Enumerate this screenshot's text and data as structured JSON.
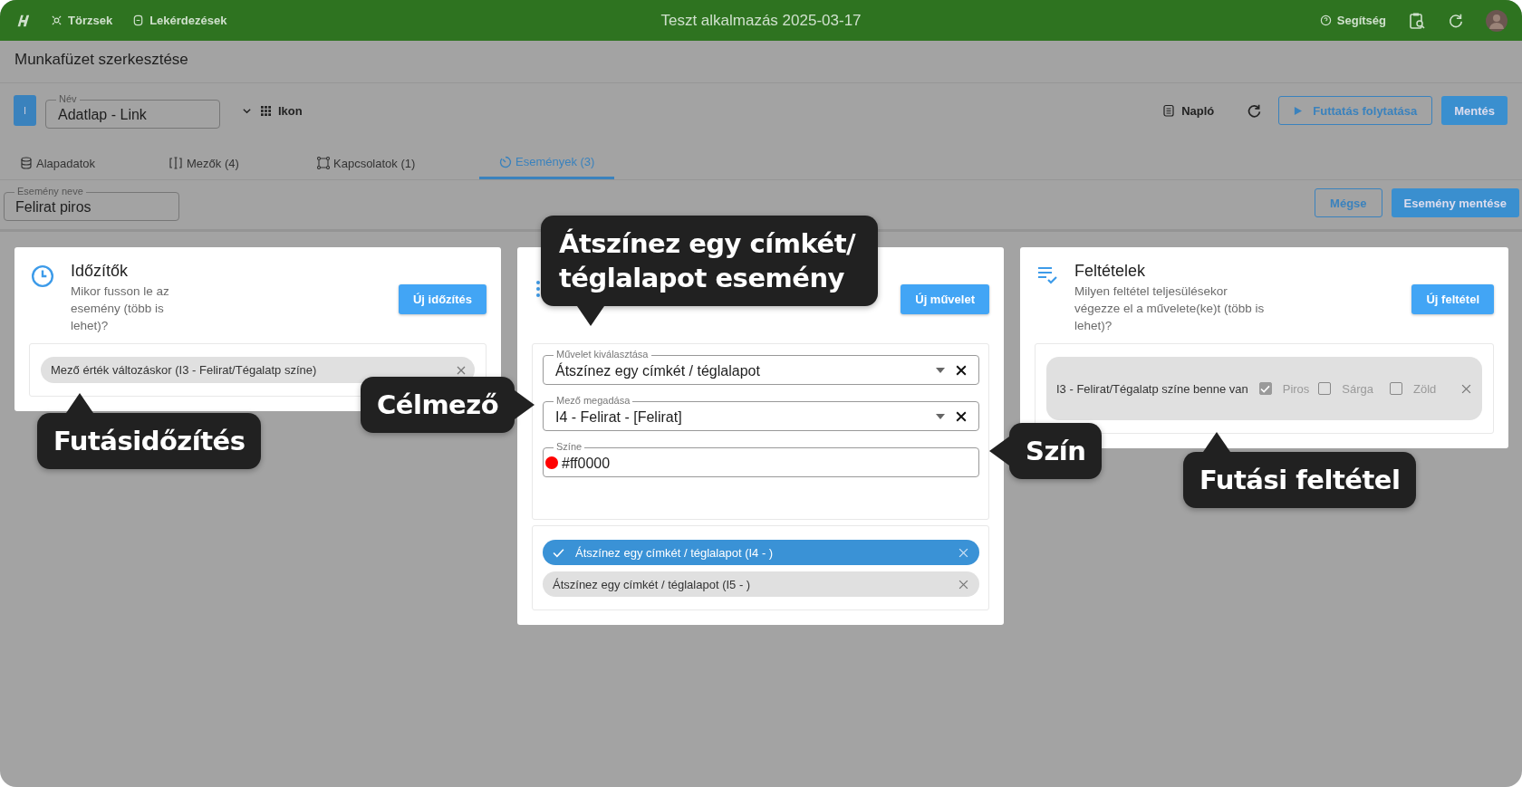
{
  "header": {
    "nav": [
      "Törzsek",
      "Lekérdezések"
    ],
    "title": "Teszt alkalmazás 2025-03-17",
    "help": "Segítség"
  },
  "page_title": "Munkafüzet szerkesztése",
  "toolbar": {
    "badge": "I",
    "name_field": {
      "label": "Név",
      "value": "Adatlap - Link"
    },
    "icon_picker": "Ikon",
    "log": "Napló",
    "run_button": "Futtatás folytatása",
    "save_button": "Mentés"
  },
  "tabs": [
    {
      "label": "Alapadatok",
      "selected": false
    },
    {
      "label": "Mezők (4)",
      "selected": false
    },
    {
      "label": "Kapcsolatok (1)",
      "selected": false
    },
    {
      "label": "Események (3)",
      "selected": true
    }
  ],
  "event": {
    "name_field": {
      "label": "Esemény neve",
      "value": "Felirat piros"
    },
    "cancel_button": "Mégse",
    "save_button": "Esemény mentése"
  },
  "timers": {
    "title": "Időzítők",
    "description": "Mikor fusson le az esemény (több is lehet)?",
    "button": "Új időzítés",
    "chips": [
      "Mező érték változáskor (I3 - Felirat/Tégalatp színe)"
    ]
  },
  "actions": {
    "button": "Új művelet",
    "fields": [
      {
        "kind": "select",
        "label": "Művelet kiválasztása",
        "value": "Átszínez egy címkét / téglalapot"
      },
      {
        "kind": "select",
        "label": "Mező megadása",
        "value": "I4 - Felirat - [Felirat]"
      },
      {
        "kind": "color",
        "label": "Színe",
        "value": "#ff0000",
        "color": "#ff0000"
      }
    ],
    "items": [
      {
        "label": "Átszínez egy címkét / téglalapot (I4 - )",
        "selected": true
      },
      {
        "label": "Átszínez egy címkét / téglalapot (I5 - )",
        "selected": false
      }
    ]
  },
  "conditions": {
    "title": "Feltételek",
    "description": "Milyen feltétel teljesülésekor végezze el a művelete(ke)t (több is lehet)?",
    "button": "Új feltétel",
    "rule": {
      "text": "I3 - Felirat/Tégalatp színe benne van",
      "options": [
        {
          "label": "Piros",
          "checked": true
        },
        {
          "label": "Sárga",
          "checked": false
        },
        {
          "label": "Zöld",
          "checked": false
        }
      ]
    }
  },
  "callouts": [
    {
      "text": "Átszínez egy címkét/ téglalapot esemény"
    },
    {
      "text": "Célmező"
    },
    {
      "text": "Futásidőzítés"
    },
    {
      "text": "Szín"
    },
    {
      "text": "Futási feltétel"
    }
  ]
}
